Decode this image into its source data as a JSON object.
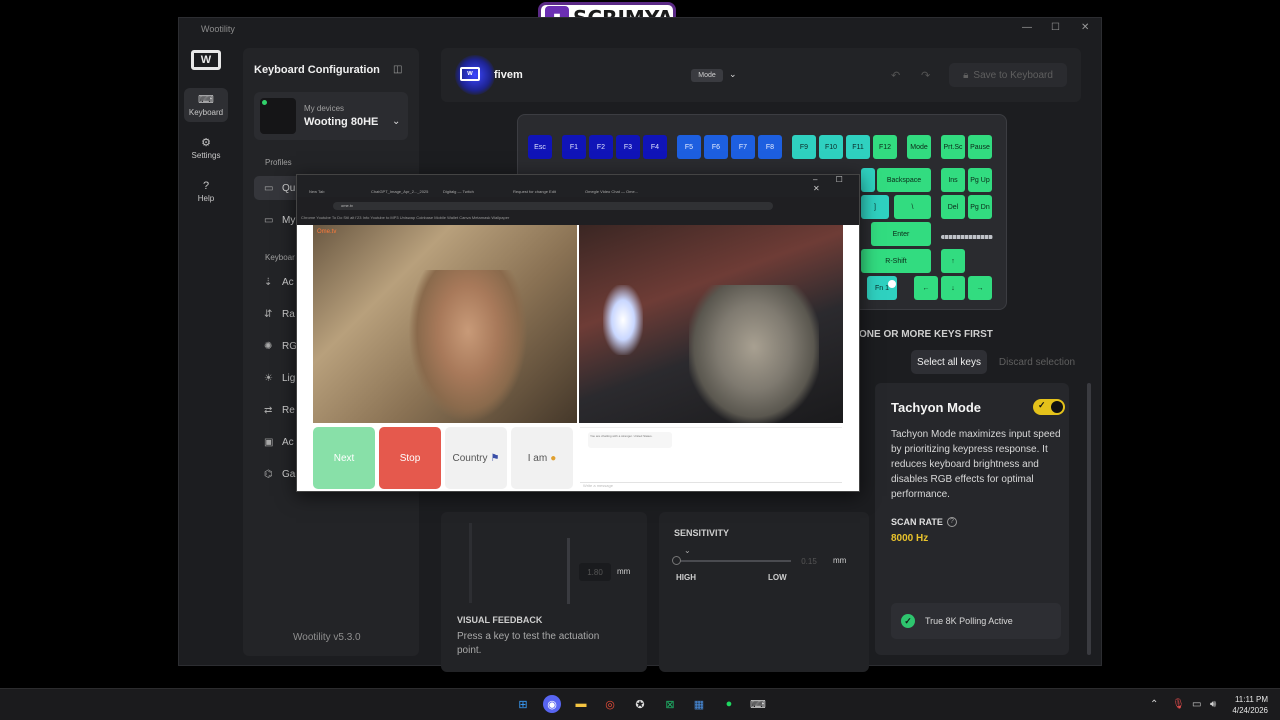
{
  "stream": {
    "channel_name": "SCRIMYA"
  },
  "window": {
    "title": "Wootility",
    "minimize": "—",
    "maximize": "☐",
    "close": "✕"
  },
  "nav": {
    "logo": "W",
    "items": [
      {
        "label": "Keyboard",
        "icon": "keyboard-icon"
      },
      {
        "label": "Settings",
        "icon": "gear-icon"
      },
      {
        "label": "Help",
        "icon": "help-icon"
      }
    ]
  },
  "sidebar": {
    "title": "Keyboard Configuration",
    "device_label": "My devices",
    "device_name": "Wooting 80HE",
    "profiles_label": "Profiles",
    "profiles": [
      "Qu",
      "My"
    ],
    "keyboard_label": "Keyboar",
    "keyboard_items": [
      "Ac",
      "Ra",
      "RG",
      "Lig",
      "Re",
      "Ac",
      "Ga"
    ],
    "version": "Wootility v5.3.0"
  },
  "header": {
    "profile_name": "fivem",
    "mode_label": "Mode",
    "save_label": "Save to Keyboard"
  },
  "keyboard": {
    "row1": [
      "Esc",
      "F1",
      "F2",
      "F3",
      "F4",
      "F5",
      "F6",
      "F7",
      "F8",
      "F9",
      "F10",
      "F11",
      "F12",
      "Mode",
      "Prt.Sc",
      "Pause"
    ],
    "backspace": "Backspace",
    "ins": "Ins",
    "pgup": "Pg Up",
    "bracket": "]",
    "backslash": "\\",
    "del": "Del",
    "pgdn": "Pg Dn",
    "enter": "Enter",
    "rshift": "R-Shift",
    "up": "↑",
    "fn": "Fn 1",
    "left": "←",
    "down": "↓",
    "right": "→"
  },
  "selection": {
    "message": "ONE OR MORE KEYS FIRST",
    "select_all": "Select all keys",
    "discard": "Discard selection"
  },
  "tachyon": {
    "title": "Tachyon Mode",
    "enabled": true,
    "description": "Tachyon Mode maximizes input speed by prioritizing keypress response. It reduces keyboard brightness and disables RGB effects for optimal performance.",
    "scan_rate_label": "SCAN RATE",
    "scan_rate_value": "8000 Hz",
    "polling_status": "True 8K Polling Active"
  },
  "actuation": {
    "value": "1.80",
    "unit": "mm",
    "visual_feedback_title": "VISUAL FEEDBACK",
    "visual_feedback_desc": "Press a key to test the actuation point."
  },
  "sensitivity": {
    "title": "SENSITIVITY",
    "value": "0.15",
    "unit": "mm",
    "high": "HIGH",
    "low": "LOW"
  },
  "browser": {
    "tabs": [
      "New Tab",
      "ChatGPT_Image_Apr_2..._2025",
      "Digitalg — Twitch",
      "Request for change Edit",
      "Omegle Video Chat — Ome..."
    ],
    "url": "ome.tv",
    "bookmarks": "Chrome   Youtube   To Do   Stil ait l'23   Info   Youtube to MP3   Uniswap   Coinbase   Mobile Wallet   Canva   Metamask   Wallpaper",
    "site_tag": "Ome.tv",
    "buttons": {
      "next": "Next",
      "stop": "Stop",
      "country": "Country",
      "iam": "I am"
    },
    "chat_text": "You are chatting with a stranger. United States.",
    "chat_placeholder": "Write a message"
  },
  "taskbar": {
    "time": "11:11 PM",
    "date": "4/24/2026"
  }
}
